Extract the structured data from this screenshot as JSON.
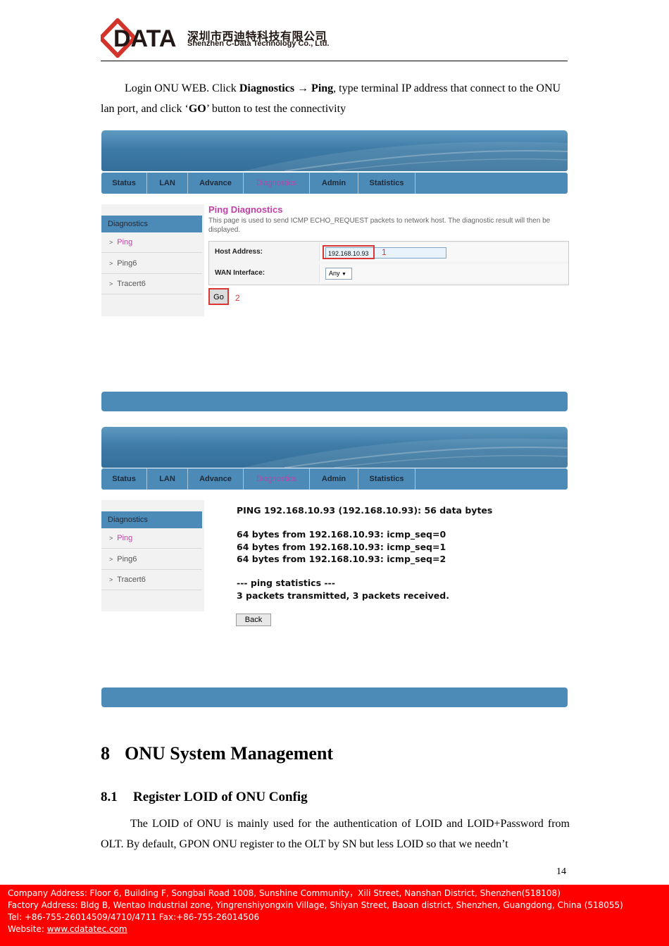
{
  "header": {
    "logo_text": "DATA",
    "company_cn": "深圳市西迪特科技有限公司",
    "company_en": "Shenzhen C-Data Technology Co., Ltd."
  },
  "intro": {
    "t1": "Login ONU WEB. Click ",
    "t2": "Diagnostics",
    "arrow": " → ",
    "t3": "Ping",
    "t4": ", type terminal IP address that connect to the ONU lan port, and click ‘",
    "t5": "GO",
    "t6": "’ button to test the connectivity"
  },
  "nav": {
    "items": [
      "Status",
      "LAN",
      "Advance",
      "Diagnostics",
      "Admin",
      "Statistics"
    ],
    "active": "Diagnostics"
  },
  "sidebar": {
    "title": "Diagnostics",
    "items": [
      "Ping",
      "Ping6",
      "Tracert6"
    ],
    "arrow": ">"
  },
  "ping_form": {
    "title": "Ping Diagnostics",
    "description": "This page is used to send ICMP ECHO_REQUEST packets to network host. The diagnostic result will then be displayed.",
    "host_label": "Host Address:",
    "host_value": "192.168.10.93",
    "wan_label": "WAN Interface:",
    "wan_value": "Any",
    "go_label": "Go",
    "marker1": "1",
    "marker2": "2"
  },
  "ping_result": {
    "line1": "PING 192.168.10.93 (192.168.10.93): 56 data bytes",
    "line2": "64 bytes from 192.168.10.93: icmp_seq=0",
    "line3": "64 bytes from 192.168.10.93: icmp_seq=1",
    "line4": "64 bytes from 192.168.10.93: icmp_seq=2",
    "line5": "--- ping statistics ---",
    "line6": "3 packets transmitted, 3 packets received.",
    "back_label": "Back"
  },
  "section8": {
    "num": "8",
    "title": "ONU System Management"
  },
  "section81": {
    "num": "8.1",
    "title": "Register LOID of ONU Config"
  },
  "body_text": "The LOID of ONU is mainly used for the authentication of LOID and LOID+Password from OLT. By default, GPON ONU register to the OLT by SN but less LOID so that we needn’t",
  "page_number": "14",
  "footer": {
    "line1": "Company Address: Floor 6, Building F, Songbai Road 1008, Sunshine Community，Xili Street, Nanshan District, Shenzhen(518108)",
    "line2": "Factory Address: Bldg B, Wentao Industrial zone, Yingrenshiyongxin Village, Shiyan Street, Baoan district, Shenzhen, Guangdong, China (518055)",
    "line3": "Tel: +86-755-26014509/4710/4711 Fax:+86-755-26014506",
    "website_label": "Website: ",
    "website_url": "www.cdatatec.com"
  },
  "colors": {
    "accent_blue": "#4c8ab8",
    "active_magenta": "#c23ea8",
    "highlight_red": "#d93636",
    "footer_red": "#ff0000",
    "logo_red": "#d2332a"
  }
}
